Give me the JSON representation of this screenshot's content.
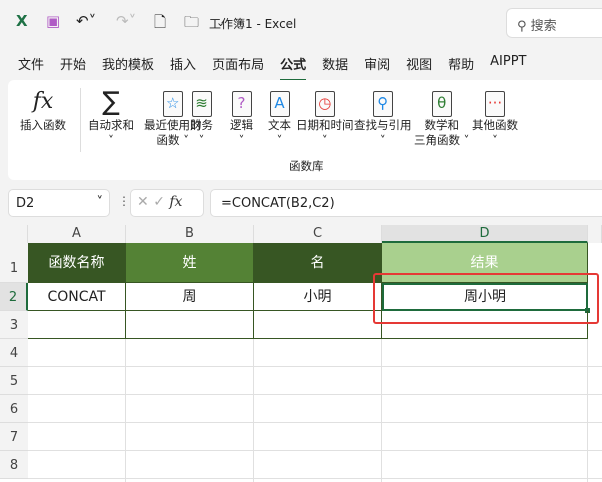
{
  "titlebar": {
    "title": "工作簿1  -  Excel",
    "search_placeholder": "搜索"
  },
  "tabs": [
    "文件",
    "开始",
    "我的模板",
    "插入",
    "页面布局",
    "公式",
    "数据",
    "审阅",
    "视图",
    "帮助",
    "AIPPT"
  ],
  "active_tab": "公式",
  "ribbon": {
    "insert_function": "插入函数",
    "autosum": "自动求和",
    "recent_1": "最近使用的",
    "recent_2": "函数",
    "financial": "财务",
    "logical": "逻辑",
    "text": "文本",
    "datetime": "日期和时间",
    "lookup": "查找与引用",
    "math_1": "数学和",
    "math_2": "三角函数",
    "other": "其他函数",
    "group_label": "函数库"
  },
  "name_box": "D2",
  "formula": "=CONCAT(B2,C2)",
  "columns": [
    "A",
    "B",
    "C",
    "D"
  ],
  "rows": [
    "1",
    "2",
    "3",
    "4",
    "5",
    "6",
    "7",
    "8"
  ],
  "cells": {
    "A1": "函数名称",
    "B1": "姓",
    "C1": "名",
    "D1": "结果",
    "A2": "CONCAT",
    "B2": "周",
    "C2": "小明",
    "D2": "周小明"
  },
  "colors": {
    "dark_green": "#375623",
    "mid_green": "#548235",
    "light_green": "#a9d08e",
    "highlight": "#e53935"
  }
}
